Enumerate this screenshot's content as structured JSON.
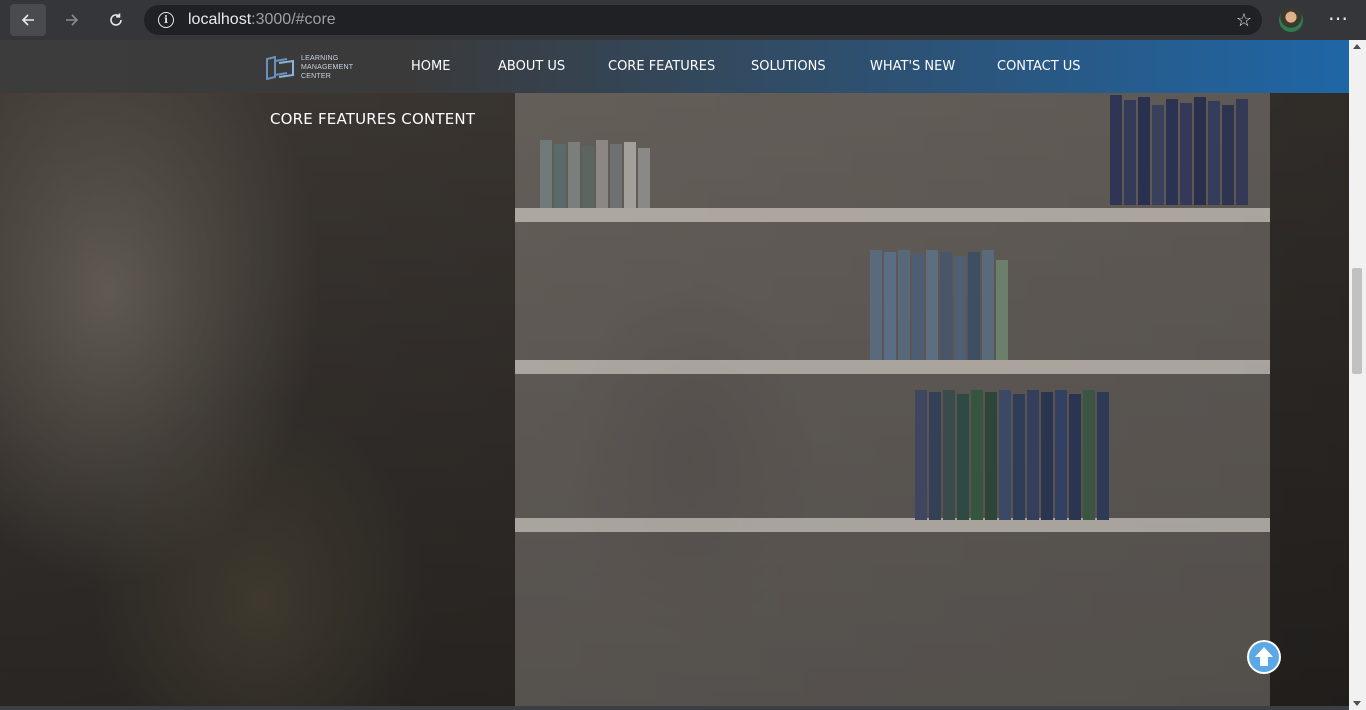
{
  "browser": {
    "url_host": "localhost",
    "url_rest": ":3000/#core",
    "back_icon": "back-arrow-icon",
    "forward_icon": "forward-arrow-icon",
    "reload_icon": "reload-icon",
    "info_icon": "info-icon",
    "star_icon": "bookmark-star-icon",
    "menu_icon": "more-menu-icon"
  },
  "navbar": {
    "logo_lines": [
      "LEARNING",
      "MANAGEMENT",
      "CENTER"
    ],
    "links": [
      {
        "label": "HOME"
      },
      {
        "label": "ABOUT US"
      },
      {
        "label": "CORE FEATURES"
      },
      {
        "label": "SOLUTIONS"
      },
      {
        "label": "WHAT'S NEW"
      },
      {
        "label": "CONTACT US"
      }
    ]
  },
  "section": {
    "title": "CORE FEATURES CONTENT"
  },
  "scroll_top": {
    "icon": "arrow-up-icon"
  },
  "colors": {
    "navbar_start": "#3c3c3c",
    "navbar_end": "#1f66a6",
    "scroll_top_arrow": "#5aa9e6"
  }
}
